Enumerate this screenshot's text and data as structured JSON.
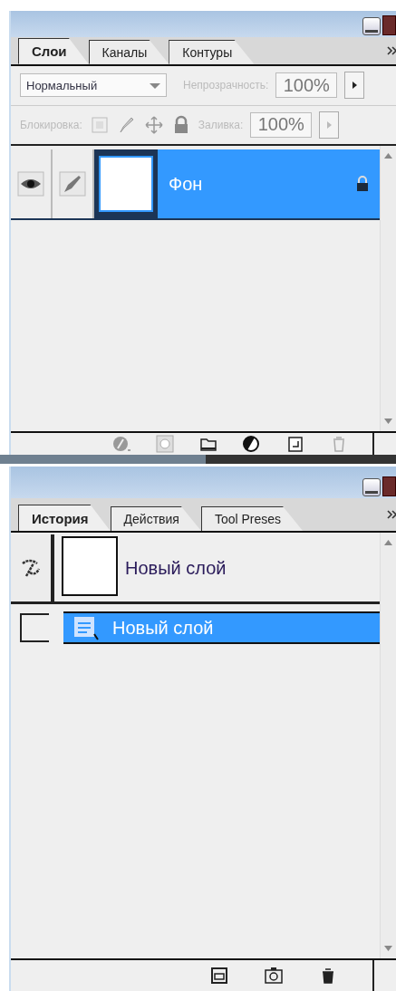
{
  "layers_panel": {
    "tabs": [
      {
        "label": "Слои",
        "selected": true
      },
      {
        "label": "Каналы",
        "selected": false
      },
      {
        "label": "Контуры",
        "selected": false
      }
    ],
    "blend_mode": {
      "value": "Нормальный"
    },
    "opacity": {
      "label": "Непрозрачность:",
      "value": "100%",
      "disabled": true
    },
    "lock": {
      "label": "Блокировка:",
      "disabled": true
    },
    "fill": {
      "label": "Заливка:",
      "value": "100%",
      "disabled": true
    },
    "layers": [
      {
        "name": "Фон",
        "visible": true,
        "selected": true,
        "locked": true
      }
    ]
  },
  "history_panel": {
    "tabs": [
      {
        "label": "История",
        "selected": true
      },
      {
        "label": "Действия",
        "selected": false
      },
      {
        "label": "Tool Preses",
        "selected": false
      }
    ],
    "snapshot": {
      "name": "Новый слой"
    },
    "states": [
      {
        "name": "Новый слой",
        "selected": true,
        "source": false
      }
    ]
  }
}
